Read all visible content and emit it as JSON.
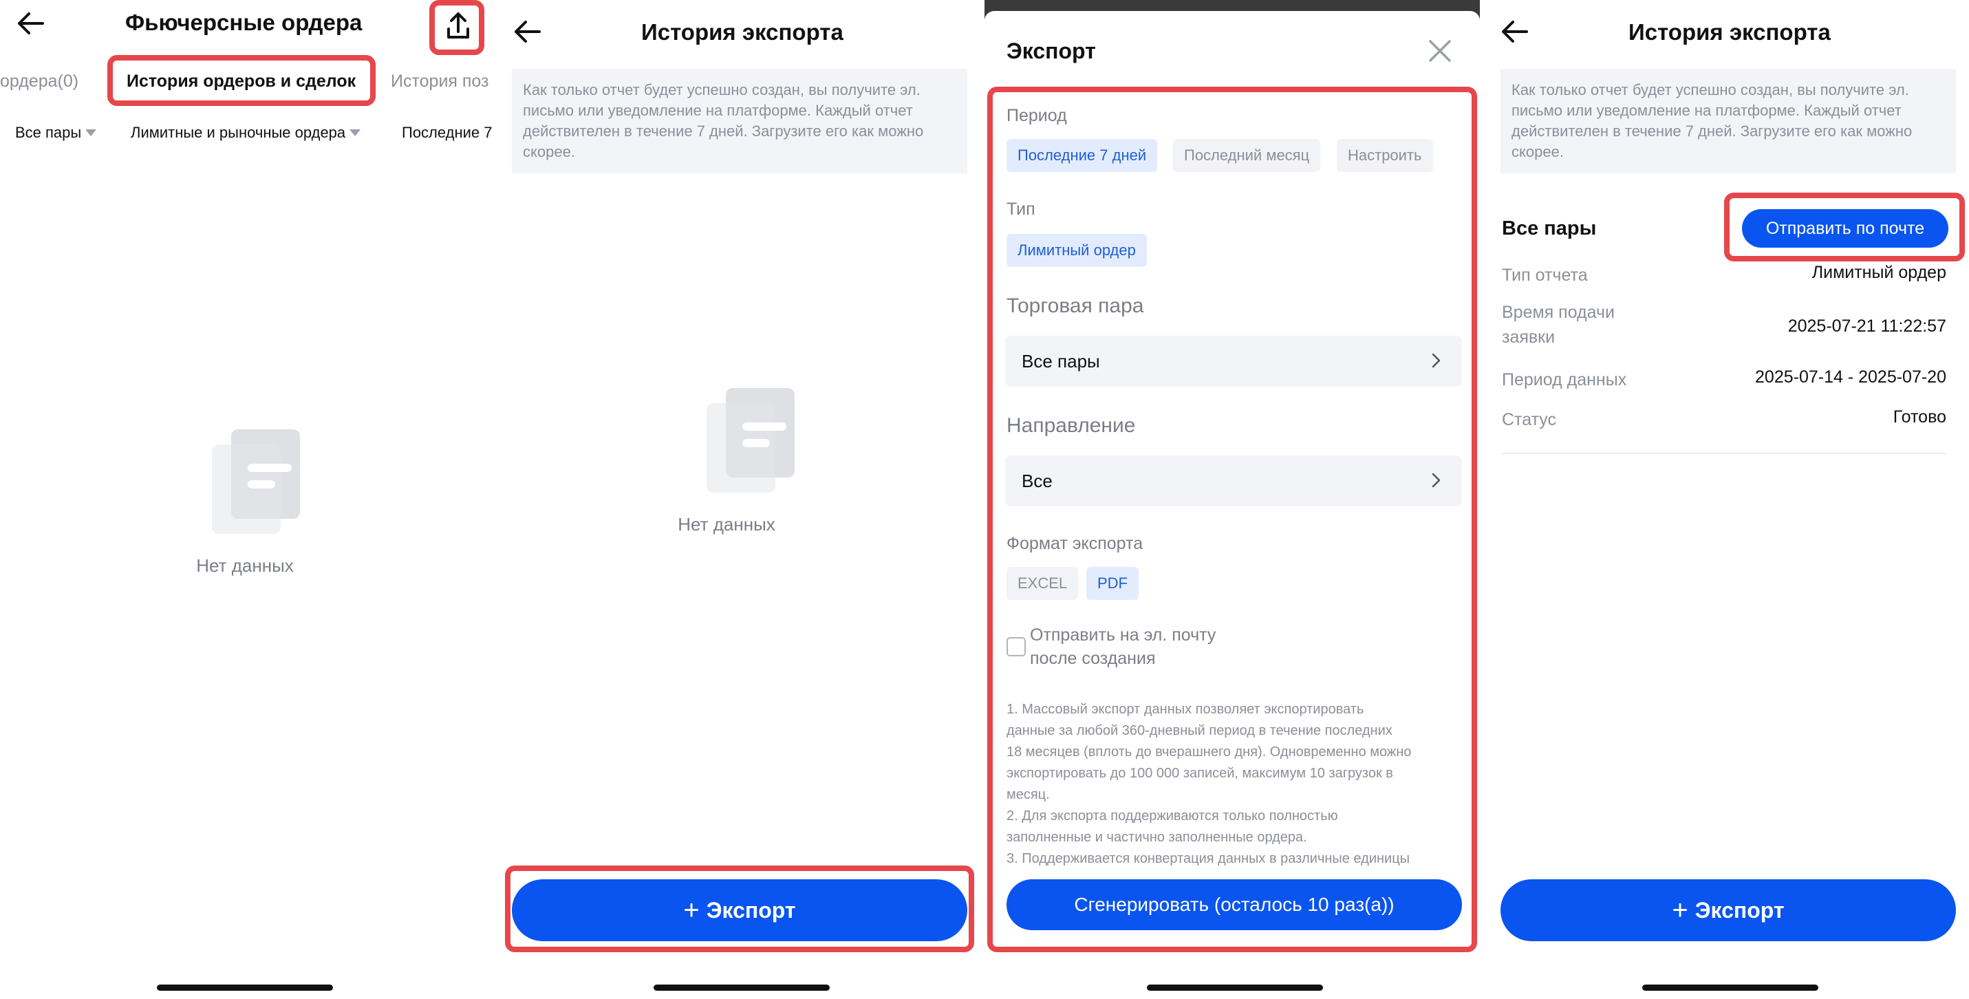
{
  "screen1": {
    "title": "Фьючерсные ордера",
    "tabs": [
      "ордера(0)",
      "История ордеров и сделок",
      "История поз"
    ],
    "filters": [
      "Все пары",
      "Лимитные и рыночные ордера",
      "Последние 7"
    ],
    "empty_text": "Нет данных"
  },
  "screen2": {
    "title": "История экспорта",
    "notice": "Как только отчет будет успешно создан, вы получите эл. письмо или уведомление на платформе. Каждый отчет действителен в течение 7 дней. Загрузите его как можно скорее.",
    "empty_text": "Нет данных",
    "export_button": "Экспорт"
  },
  "screen3": {
    "title": "Экспорт",
    "period_label": "Период",
    "period_options": [
      "Последние 7 дней",
      "Последний месяц",
      "Настроить"
    ],
    "type_label": "Тип",
    "type_option": "Лимитный ордер",
    "pair_label": "Торговая пара",
    "pair_value": "Все пары",
    "direction_label": "Направление",
    "direction_value": "Все",
    "format_label": "Формат экспорта",
    "format_options": [
      "EXCEL",
      "PDF"
    ],
    "email_checkbox_line1": "Отправить на эл. почту",
    "email_checkbox_line2": "после создания",
    "notes": [
      "1. Массовый экспорт данных позволяет экспортировать",
      "данные за любой 360-дневный период в течение последних",
      "18 месяцев (вплоть до вчерашнего дня). Одновременно можно",
      "экспортировать до 100 000 записей, максимум 10 загрузок в",
      "месяц.",
      "2. Для экспорта поддерживаются только полностью",
      "заполненные и частично заполненные ордера.",
      "3. Поддерживается конвертация данных в различные единицы"
    ],
    "generate_button": "Сгенерировать (осталось 10 раз(а))"
  },
  "screen4": {
    "title": "История экспорта",
    "notice": "Как только отчет будет успешно создан, вы получите эл. письмо или уведомление на платформе. Каждый отчет действителен в течение 7 дней. Загрузите его как можно скорее.",
    "record_title": "Все пары",
    "email_button": "Отправить по почте",
    "rows": [
      {
        "key": "Тип отчета",
        "value": "Лимитный ордер"
      },
      {
        "key_line1": "Время подачи",
        "key_line2": "заявки",
        "value": "2025-07-21 11:22:57"
      },
      {
        "key": "Период данных",
        "value": "2025-07-14 - 2025-07-20"
      },
      {
        "key": "Статус",
        "value": "Готово"
      }
    ],
    "export_button": "Экспорт"
  },
  "colors": {
    "accent": "#0a55f0",
    "highlight": "#e5474b",
    "chip_selected_bg": "#e3ecfe"
  }
}
